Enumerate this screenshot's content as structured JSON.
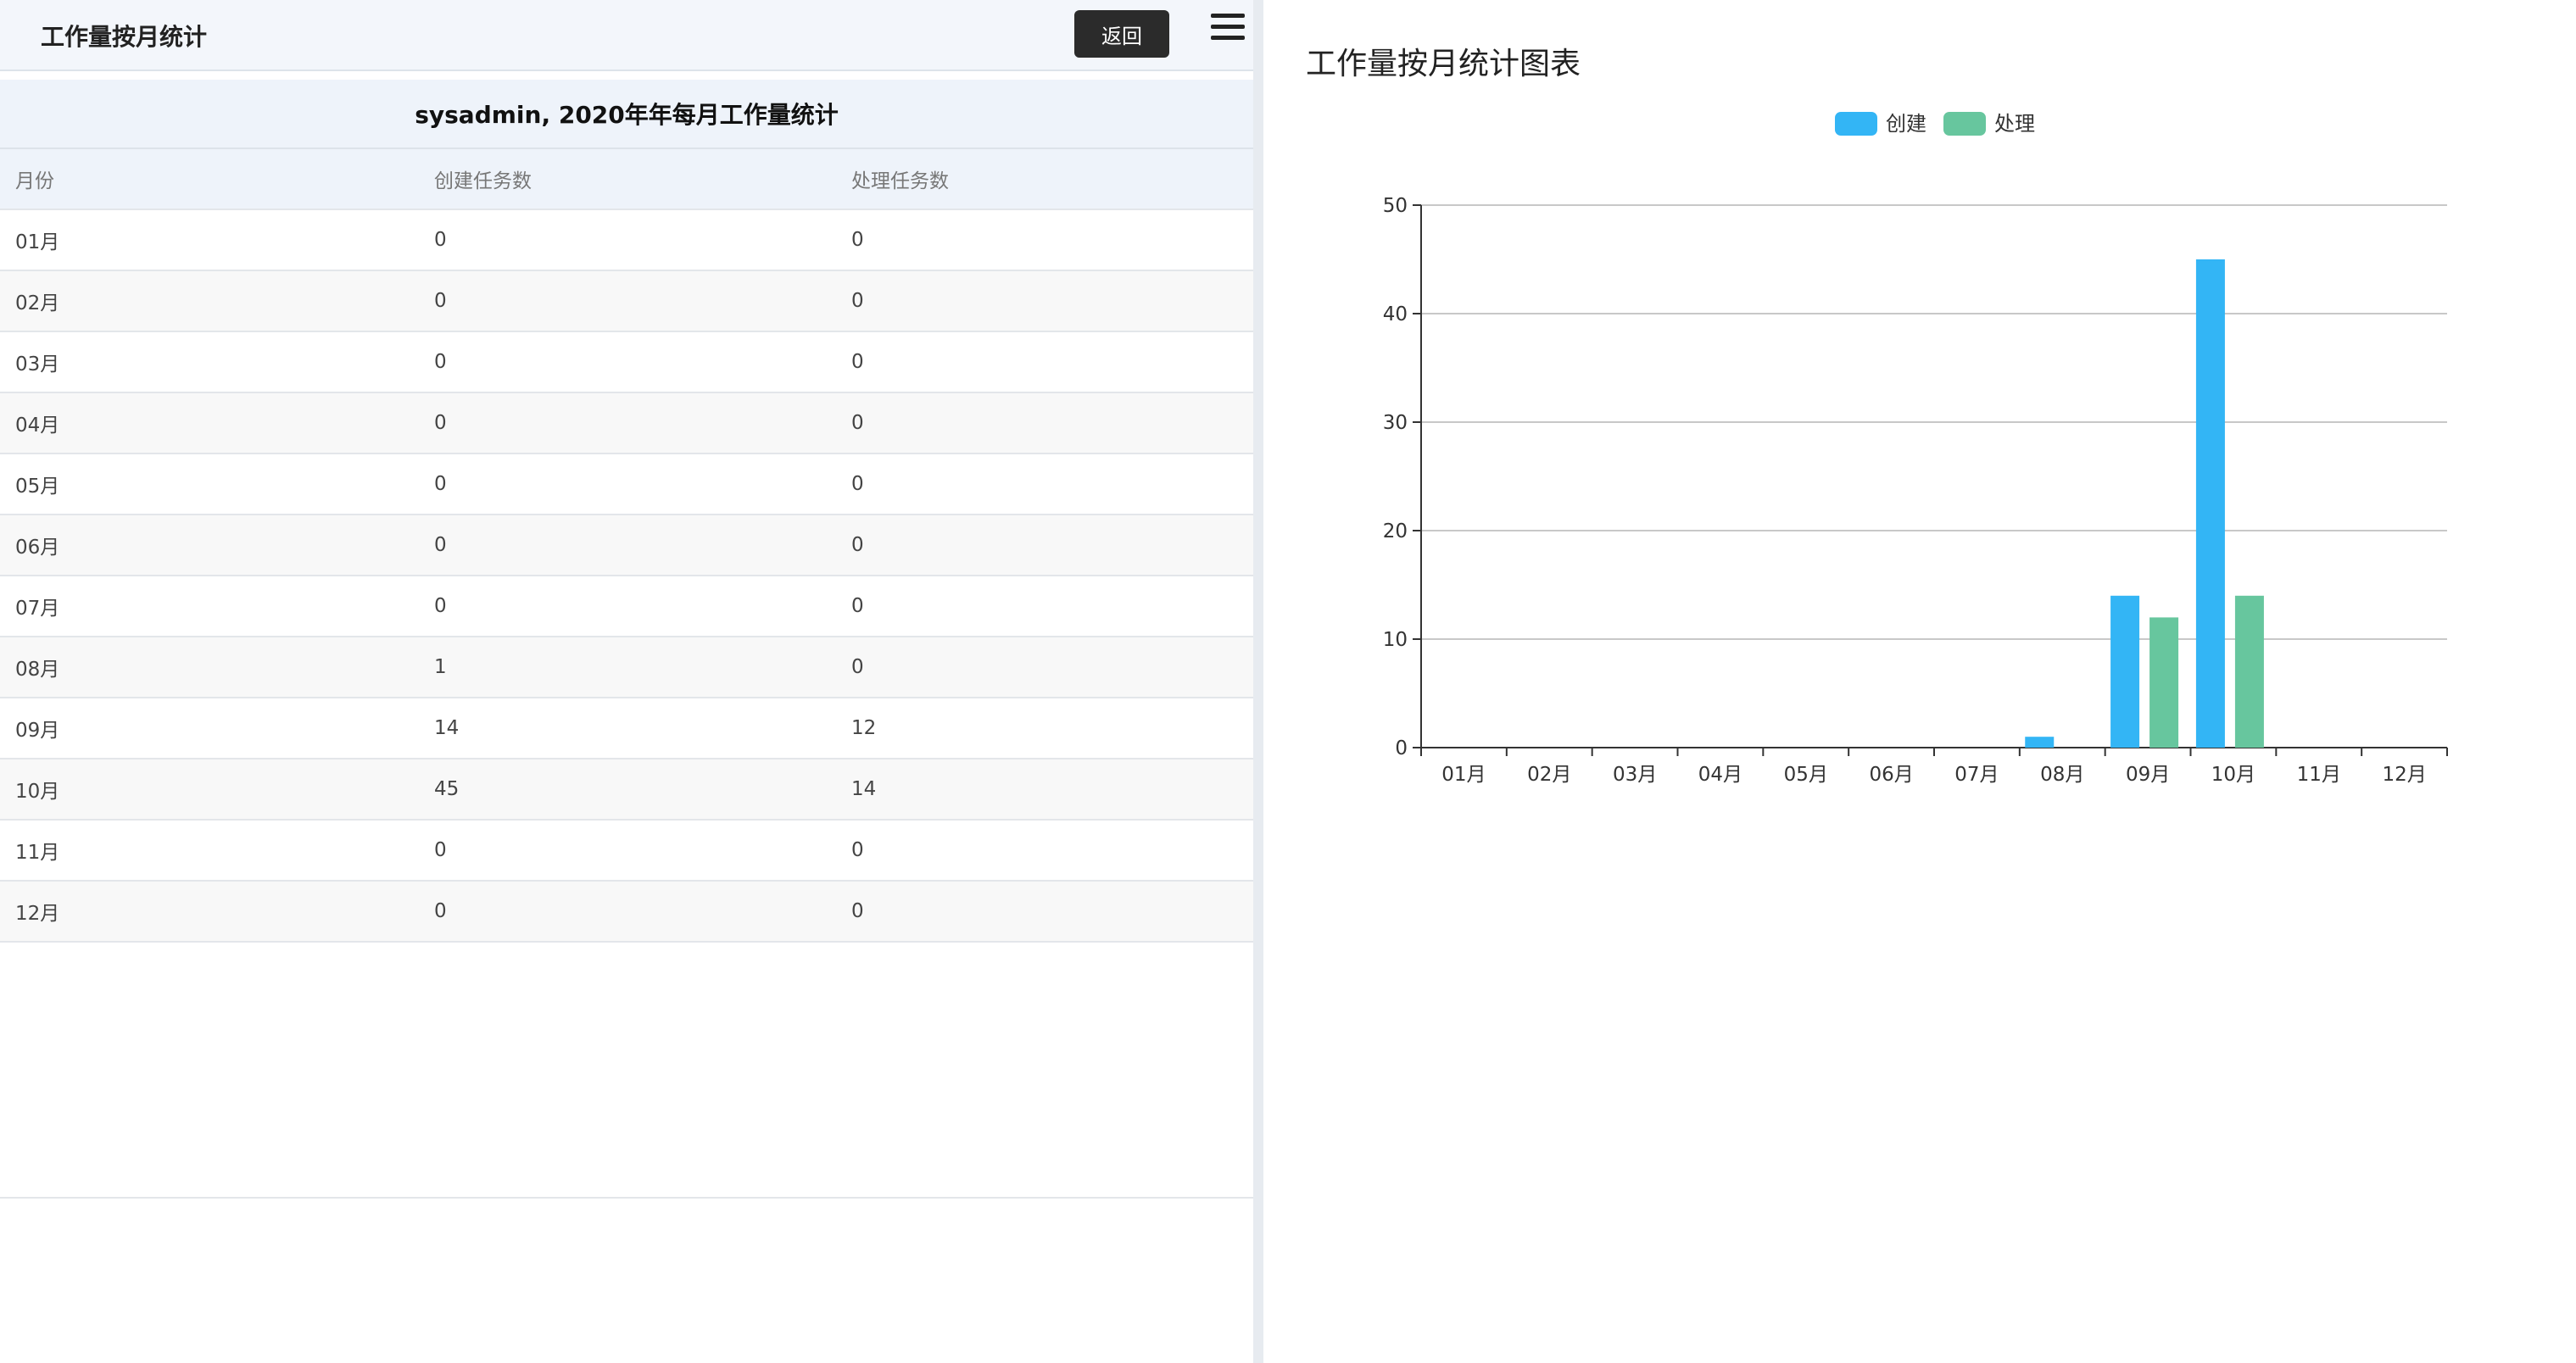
{
  "header": {
    "title": "工作量按月统计",
    "back_label": "返回"
  },
  "table": {
    "title": "sysadmin, 2020年年每月工作量统计",
    "columns": [
      "月份",
      "创建任务数",
      "处理任务数"
    ],
    "rows": [
      [
        "01月",
        "0",
        "0"
      ],
      [
        "02月",
        "0",
        "0"
      ],
      [
        "03月",
        "0",
        "0"
      ],
      [
        "04月",
        "0",
        "0"
      ],
      [
        "05月",
        "0",
        "0"
      ],
      [
        "06月",
        "0",
        "0"
      ],
      [
        "07月",
        "0",
        "0"
      ],
      [
        "08月",
        "1",
        "0"
      ],
      [
        "09月",
        "14",
        "12"
      ],
      [
        "10月",
        "45",
        "14"
      ],
      [
        "11月",
        "0",
        "0"
      ],
      [
        "12月",
        "0",
        "0"
      ]
    ]
  },
  "chart_title": "工作量按月统计图表",
  "chart_data": {
    "type": "bar",
    "categories": [
      "01月",
      "02月",
      "03月",
      "04月",
      "05月",
      "06月",
      "07月",
      "08月",
      "09月",
      "10月",
      "11月",
      "12月"
    ],
    "series": [
      {
        "name": "创建",
        "color": "#33b5f5",
        "values": [
          0,
          0,
          0,
          0,
          0,
          0,
          0,
          1,
          14,
          45,
          0,
          0
        ]
      },
      {
        "name": "处理",
        "color": "#67c69e",
        "values": [
          0,
          0,
          0,
          0,
          0,
          0,
          0,
          0,
          12,
          14,
          0,
          0
        ]
      }
    ],
    "ylim": [
      0,
      50
    ],
    "yticks": [
      0,
      10,
      20,
      30,
      40,
      50
    ],
    "grid": true,
    "legend": "top-center"
  }
}
